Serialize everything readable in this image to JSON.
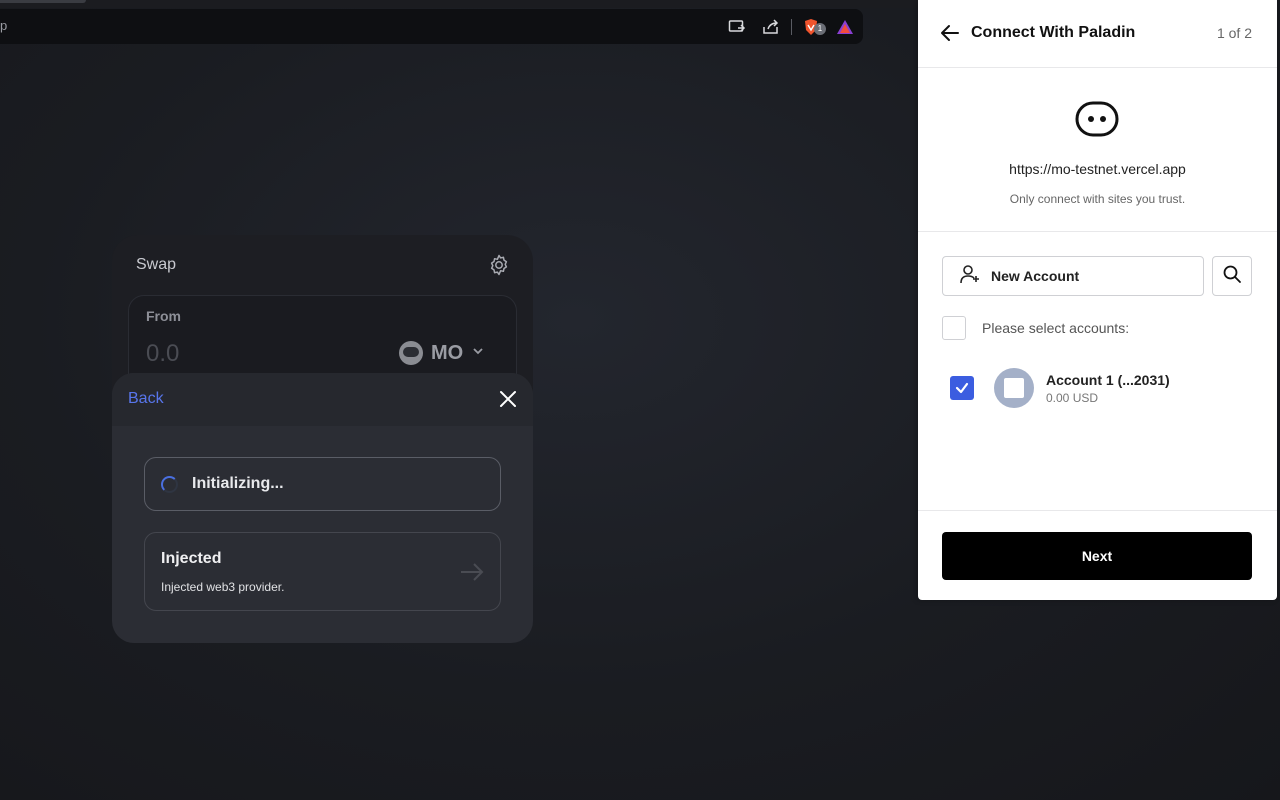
{
  "browser": {
    "address_fragment": "p",
    "extension_badge": "1"
  },
  "swap": {
    "title": "Swap",
    "from_label": "From",
    "amount_placeholder": "0.0",
    "token_symbol": "MO"
  },
  "wallet_modal": {
    "back_label": "Back",
    "initializing_label": "Initializing...",
    "injected_title": "Injected",
    "injected_description": "Injected web3 provider."
  },
  "paladin": {
    "title": "Connect With Paladin",
    "step": "1 of 2",
    "site_url": "https://mo-testnet.vercel.app",
    "trust_note": "Only connect with sites you trust.",
    "new_account_label": "New Account",
    "select_label": "Please select accounts:",
    "accounts": [
      {
        "name": "Account 1 (...2031)",
        "balance": "0.00 USD",
        "selected": true
      }
    ],
    "next_label": "Next"
  },
  "colors": {
    "accent_blue": "#5876ec",
    "checkbox_blue": "#3b5de0",
    "panel_bg": "#ffffff",
    "page_bg": "#1a1c21"
  },
  "icons": {
    "back_arrow": "arrow-left-icon",
    "search": "search-icon",
    "add_user": "user-plus-icon",
    "settings": "gear-icon",
    "close": "close-icon",
    "chevron": "chevron-down-icon",
    "arrow_right": "arrow-right-icon"
  }
}
